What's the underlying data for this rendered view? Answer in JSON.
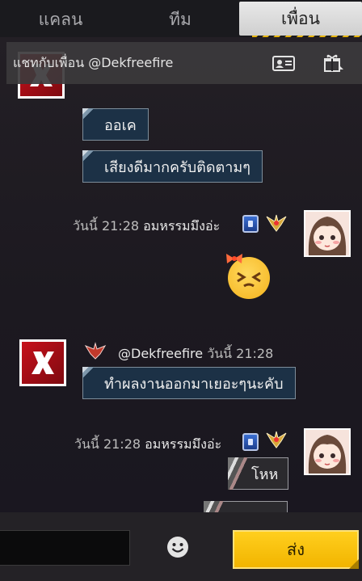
{
  "tabs": {
    "clan": "แคลน",
    "team": "ทีม",
    "friends": "เพื่อน"
  },
  "chat_header": {
    "title": "แชทกับเพื่อน @Dekfreefire"
  },
  "messages": [
    {
      "side": "left",
      "text": "ออเค"
    },
    {
      "side": "left",
      "text": "เสียงดีมากครับติดตามๆ"
    },
    {
      "side": "right",
      "time": "วันนี้ 21:28",
      "name": "อมหรรมมึงอ่ะ",
      "emoji": "laughing-face-with-bow"
    },
    {
      "side": "left",
      "name": "@Dekfreefire",
      "time": "วันนี้ 21:28",
      "text": "ทำผลงานออกมาเยอะๆนะคับ"
    },
    {
      "side": "right",
      "time": "วันนี้ 21:28",
      "name": "อมหรรมมึงอ่ะ",
      "text": "โหห"
    }
  ],
  "composer": {
    "input_value": "",
    "send_label": "ส่ง"
  },
  "colors": {
    "accent": "#f7c00f",
    "bubble_left": "#1c3146",
    "tab_active": "#dcdcdc"
  },
  "icons": [
    "profile-card-icon",
    "gift-icon",
    "smiley-icon"
  ]
}
